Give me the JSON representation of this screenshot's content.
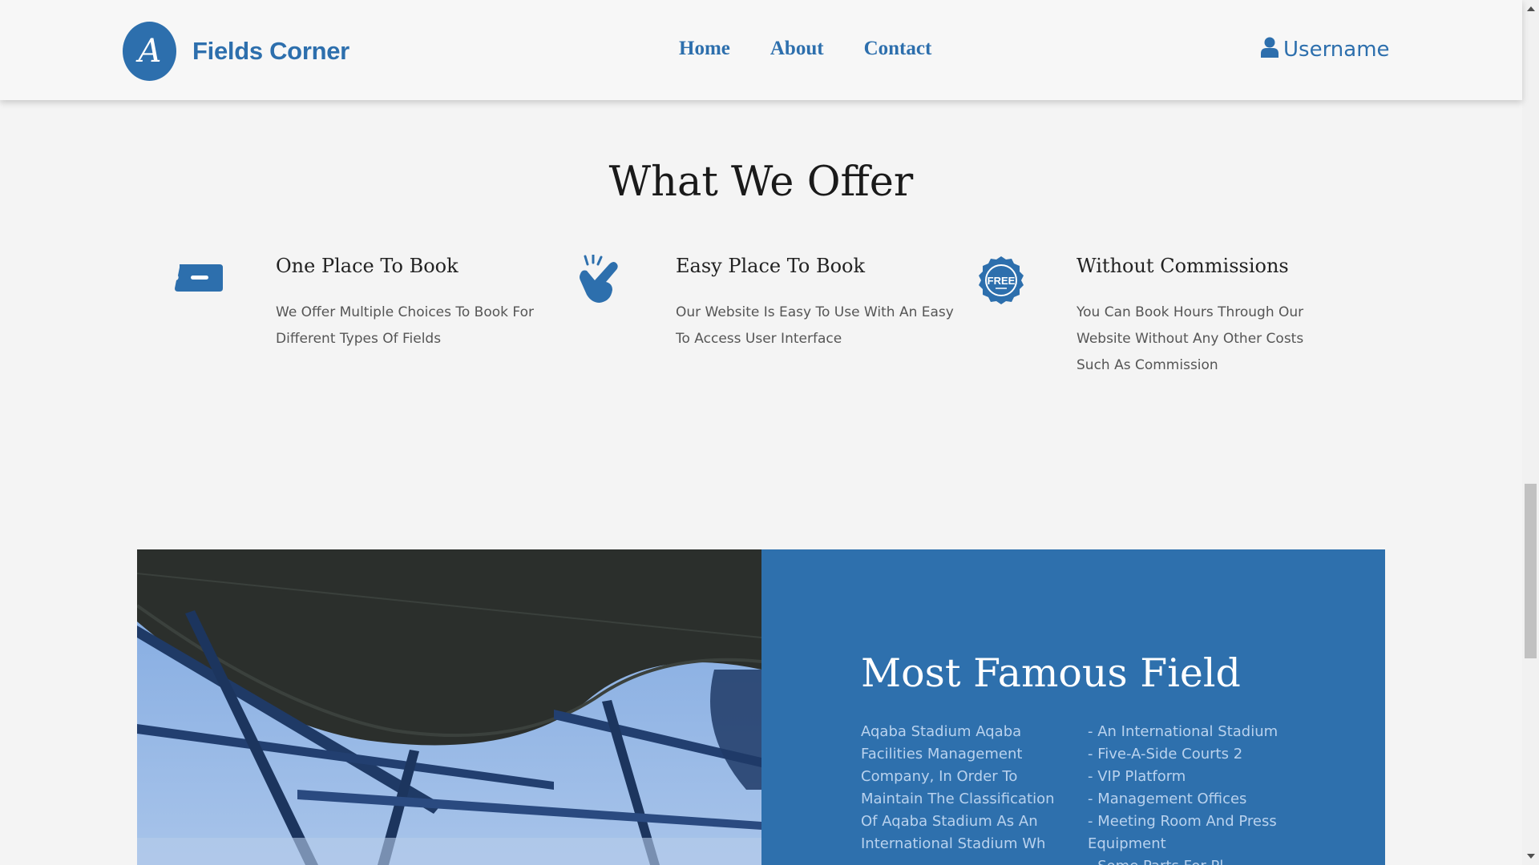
{
  "brand": {
    "name": "Fields Corner",
    "logo_letter": "A"
  },
  "nav": {
    "links": [
      "Home",
      "About",
      "Contact"
    ]
  },
  "user": {
    "name": "Username"
  },
  "offer": {
    "title": "What We Offer",
    "features": [
      {
        "icon": "ticket-icon",
        "title": "One Place To Book",
        "desc": "We Offer Multiple Choices To Book For Different Types Of Fields"
      },
      {
        "icon": "snap-fingers-icon",
        "title": "Easy Place To Book",
        "desc": "Our Website Is Easy To Use With An Easy To Access User Interface"
      },
      {
        "icon": "free-badge-icon",
        "badge_text": "FREE",
        "title": "Without Commissions",
        "desc": "You Can Book Hours Through Our Website Without Any Other Costs Such As Commission"
      }
    ]
  },
  "famous": {
    "title": "Most Famous Field",
    "left_text": "Aqaba Stadium Aqaba Facilities Management Company, In Order To Maintain The Classification Of Aqaba Stadium As An International Stadium Wh",
    "right_items": [
      "- An International Stadium",
      "- Five-A-Side Courts 2",
      "- VIP Platform",
      "- Management Offices",
      "- Meeting Room And Press Equipment",
      "- Some Parts For Pl"
    ]
  },
  "colors": {
    "brand_blue": "#2d6fad",
    "panel_blue": "#2e70ad",
    "page_bg": "#f4f4f4"
  }
}
